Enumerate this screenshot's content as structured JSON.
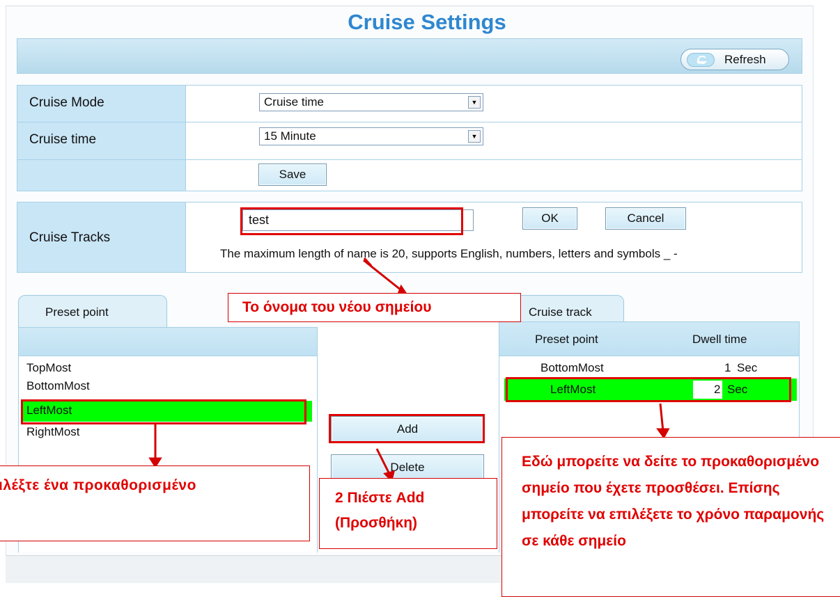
{
  "page": {
    "title": "Cruise Settings"
  },
  "toolbar": {
    "refresh_label": "Refresh"
  },
  "settings": {
    "cruise_mode_label": "Cruise Mode",
    "cruise_mode_value": "Cruise time",
    "cruise_time_label": "Cruise time",
    "cruise_time_value": "15 Minute",
    "save_label": "Save"
  },
  "tracks": {
    "label": "Cruise Tracks",
    "name_value": "test",
    "ok_label": "OK",
    "cancel_label": "Cancel",
    "hint": "The maximum length of name is 20, supports English, numbers, letters and symbols _ -"
  },
  "preset_panel": {
    "tab_label": "Preset point",
    "items": [
      "TopMost",
      "BottomMost",
      "LeftMost",
      "RightMost"
    ],
    "selected": "LeftMost"
  },
  "actions": {
    "add_label": "Add",
    "delete_label": "Delete"
  },
  "track_panel": {
    "tab_label": "Cruise track",
    "col_preset": "Preset point",
    "col_dwell": "Dwell time",
    "rows": [
      {
        "point": "BottomMost",
        "dwell": "1",
        "unit": "Sec"
      },
      {
        "point": "LeftMost",
        "dwell": "2",
        "unit": "Sec"
      }
    ]
  },
  "callouts": {
    "name": "Το    όνομα του νέου σημείου",
    "select": "ιλέξτε    ένα    προκαθορισμένο",
    "add": "2   Πιέστε   Add (Προσθήκη)",
    "track": "Εδώ μπορείτε να δείτε το προκαθορισμένο σημείο που έχετε προσθέσει. Επίσης μπορείτε να επιλέξετε το χρόνο παραμονής σε κάθε σημείο"
  },
  "colors": {
    "title": "#2f87d0",
    "annotation": "#e00000",
    "highlight": "#00ff00",
    "panel": "#c9e6f6"
  }
}
